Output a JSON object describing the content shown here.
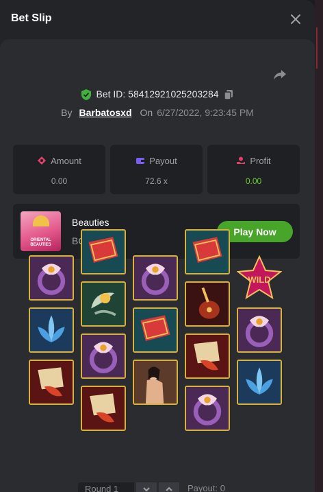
{
  "header": {
    "title": "Bet Slip"
  },
  "bet": {
    "id_label": "Bet ID:",
    "id_value": "58412921025203284",
    "by_label": "By",
    "username": "Barbatosxd",
    "on_label": "On",
    "datetime": "6/27/2022, 9:23:45 PM"
  },
  "stats": [
    {
      "label": "Amount",
      "value": "0.00",
      "icon": "amount-icon",
      "color": "#e0416a"
    },
    {
      "label": "Payout",
      "value": "72.6 x",
      "icon": "wallet-icon",
      "color": "#7a5cf0"
    },
    {
      "label": "Profit",
      "value": "0.00",
      "icon": "profit-icon",
      "color": "#e0416a",
      "value_color": "#6cd12a"
    }
  ],
  "game": {
    "name": "Beauties",
    "provider": "BC Original",
    "thumb_text": "ORIENTAL BEAUTIES",
    "play_label": "Play Now"
  },
  "reels": [
    [
      "ring",
      "lotus",
      "koi"
    ],
    [
      "book",
      "fan",
      "ring",
      "koi"
    ],
    [
      "ring",
      "book",
      "beauty"
    ],
    [
      "book",
      "pipa",
      "koi",
      "ring"
    ],
    [
      "wild",
      "ring",
      "lotus"
    ]
  ],
  "wild_text": "WILD",
  "round": {
    "label": "Round 1",
    "payout_label": "Payout: 0"
  },
  "colors": {
    "accent_green": "#47a52a",
    "frame_gold": "#d9b23c",
    "bg": "#2b2c30"
  }
}
